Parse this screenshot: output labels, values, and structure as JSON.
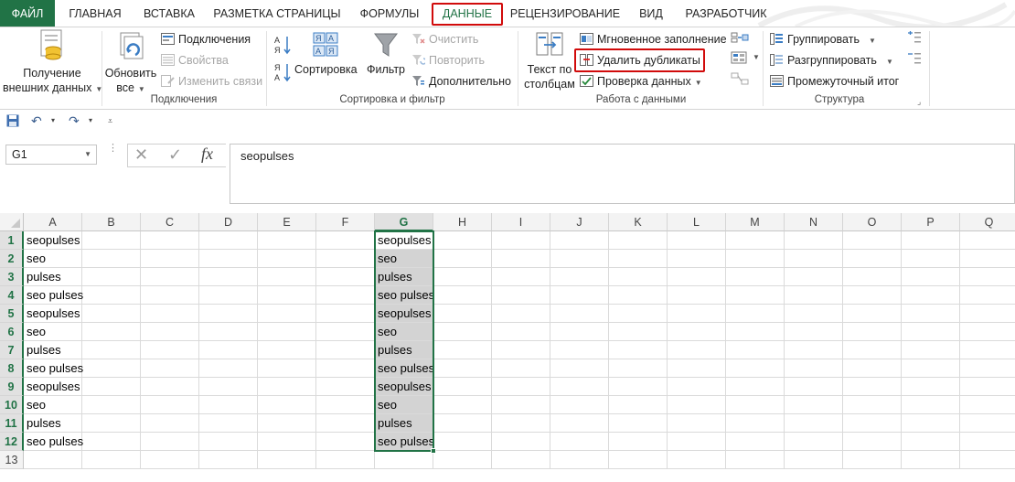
{
  "tabs": [
    {
      "label": "ФАЙЛ"
    },
    {
      "label": "ГЛАВНАЯ"
    },
    {
      "label": "ВСТАВКА"
    },
    {
      "label": "РАЗМЕТКА СТРАНИЦЫ"
    },
    {
      "label": "ФОРМУЛЫ"
    },
    {
      "label": "ДАННЫЕ"
    },
    {
      "label": "РЕЦЕНЗИРОВАНИЕ"
    },
    {
      "label": "ВИД"
    },
    {
      "label": "РАЗРАБОТЧИК"
    }
  ],
  "ribbon": {
    "get_external": {
      "line1": "Получение",
      "line2": "внешних данных"
    },
    "connections": {
      "refresh_line1": "Обновить",
      "refresh_line2": "все",
      "connections": "Подключения",
      "properties": "Свойства",
      "edit_links": "Изменить связи",
      "group_label": "Подключения"
    },
    "sort_filter": {
      "sort": "Сортировка",
      "filter": "Фильтр",
      "clear": "Очистить",
      "reapply": "Повторить",
      "advanced": "Дополнительно",
      "group_label": "Сортировка и фильтр"
    },
    "data_tools": {
      "text_to_columns_line1": "Текст по",
      "text_to_columns_line2": "столбцам",
      "flash_fill": "Мгновенное заполнение",
      "remove_duplicates": "Удалить дубликаты",
      "data_validation": "Проверка данных",
      "group_label": "Работа с данными"
    },
    "outline": {
      "group": "Группировать",
      "ungroup": "Разгруппировать",
      "subtotal": "Промежуточный итог",
      "group_label": "Структура"
    }
  },
  "formula_bar": {
    "name_box": "G1",
    "value": "seopulses"
  },
  "columns": [
    "A",
    "B",
    "C",
    "D",
    "E",
    "F",
    "G",
    "H",
    "I",
    "J",
    "K",
    "L",
    "M",
    "N",
    "O",
    "P",
    "Q"
  ],
  "rows": [
    "1",
    "2",
    "3",
    "4",
    "5",
    "6",
    "7",
    "8",
    "9",
    "10",
    "11",
    "12",
    "13"
  ],
  "col_a": [
    "seopulses",
    "seo",
    "pulses",
    "seo pulses",
    "seopulses",
    "seo",
    "pulses",
    "seo pulses",
    "seopulses",
    "seo",
    "pulses",
    "seo pulses"
  ],
  "col_g": [
    "seopulses",
    "seo",
    "pulses",
    "seo pulses",
    "seopulses",
    "seo",
    "pulses",
    "seo pulses",
    "seopulses",
    "seo",
    "pulses",
    "seo pulses"
  ],
  "colors": {
    "accent": "#217346",
    "highlight": "#d10b0b",
    "selection_fill": "#d3d3d3"
  }
}
